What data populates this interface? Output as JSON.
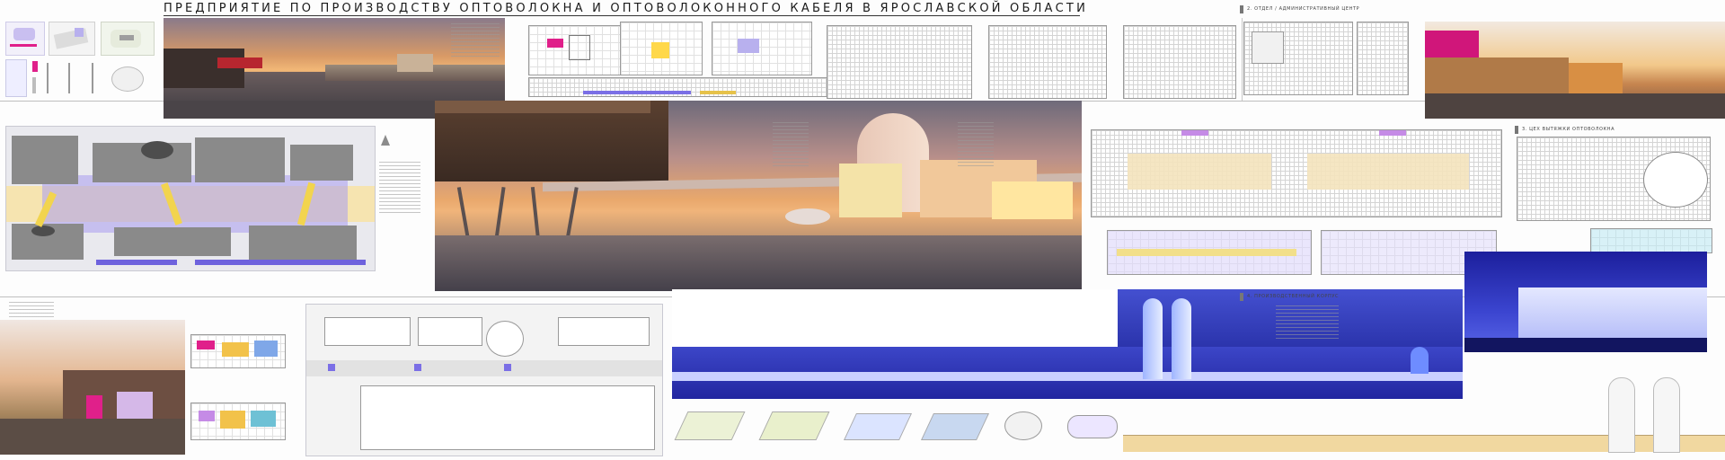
{
  "header": {
    "title": "Предприятие по производству оптоволокна и оптоволоконного кабеля в Ярославской области",
    "label_admin_center": "2. Отдел / административный центр",
    "label_shop": "3. Цех вытяжки оптоволокна",
    "label_production": "4. Производственный корпус"
  },
  "colors": {
    "accent_purple": "#7b6fe6",
    "accent_magenta": "#e0208a",
    "accent_yellow": "#e6c24a",
    "sky_warm": "#e8a060",
    "night_blue": "#2430b0"
  },
  "icons": {
    "north_arrow": "north-arrow-icon"
  }
}
